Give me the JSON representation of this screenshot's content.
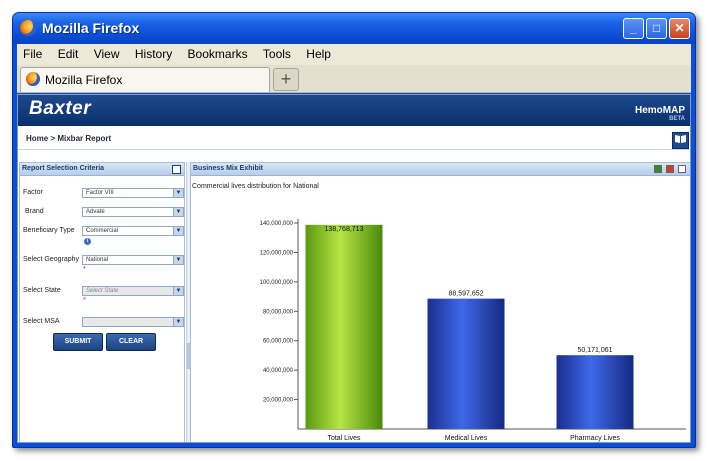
{
  "window": {
    "title": "Mozilla Firefox",
    "min_icon": "_",
    "max_icon": "□",
    "close_icon": "✕"
  },
  "menu": [
    "File",
    "Edit",
    "View",
    "History",
    "Bookmarks",
    "Tools",
    "Help"
  ],
  "tab": {
    "label": "Mozilla Firefox",
    "new_tab_symbol": "+"
  },
  "app": {
    "brand": "Baxter",
    "product": "HemoMAP",
    "badge": "BETA",
    "breadcrumb": "Home > Mixbar Report",
    "help_icon": "book-icon"
  },
  "criteria": {
    "title": "Report Selection Criteria",
    "fields": [
      {
        "label": "Factor",
        "value": "Factor VIII",
        "required": false
      },
      {
        "label": "Brand",
        "value": "Advate",
        "required": false
      },
      {
        "label": "Beneficiary Type",
        "value": "Commercial",
        "required": false
      },
      {
        "label": "Select Geography",
        "value": "National",
        "required": true
      },
      {
        "label": "Select State",
        "value": "Select State",
        "required": true
      },
      {
        "label": "Select MSA",
        "value": "",
        "required": false
      }
    ],
    "required_mark": "*",
    "info_glyph": "i",
    "submit_label": "SUBMIT",
    "clear_label": "CLEAR"
  },
  "exhibit": {
    "title": "Business Mix Exhibit",
    "subtitle": "Commercial lives distribution for National"
  },
  "colors": {
    "accent": "#1d4a8e",
    "bar_total": "#7fc21b",
    "bar_other": "#1f3fb0"
  },
  "chart_data": {
    "type": "bar",
    "categories": [
      "Total Lives",
      "Medical Lives",
      "Pharmacy Lives"
    ],
    "values": [
      138768713,
      88597652,
      50171061
    ],
    "value_labels": [
      "138,768,713",
      "88,597,652",
      "50,171,061"
    ],
    "ylim": [
      0,
      140000000
    ],
    "yticks": [
      "20,000,000",
      "40,000,000",
      "60,000,000",
      "80,000,000",
      "100,000,000",
      "120,000,000",
      "140,000,000"
    ],
    "ytick_values": [
      20000000,
      40000000,
      60000000,
      80000000,
      100000000,
      120000000,
      140000000
    ],
    "grid": false
  }
}
